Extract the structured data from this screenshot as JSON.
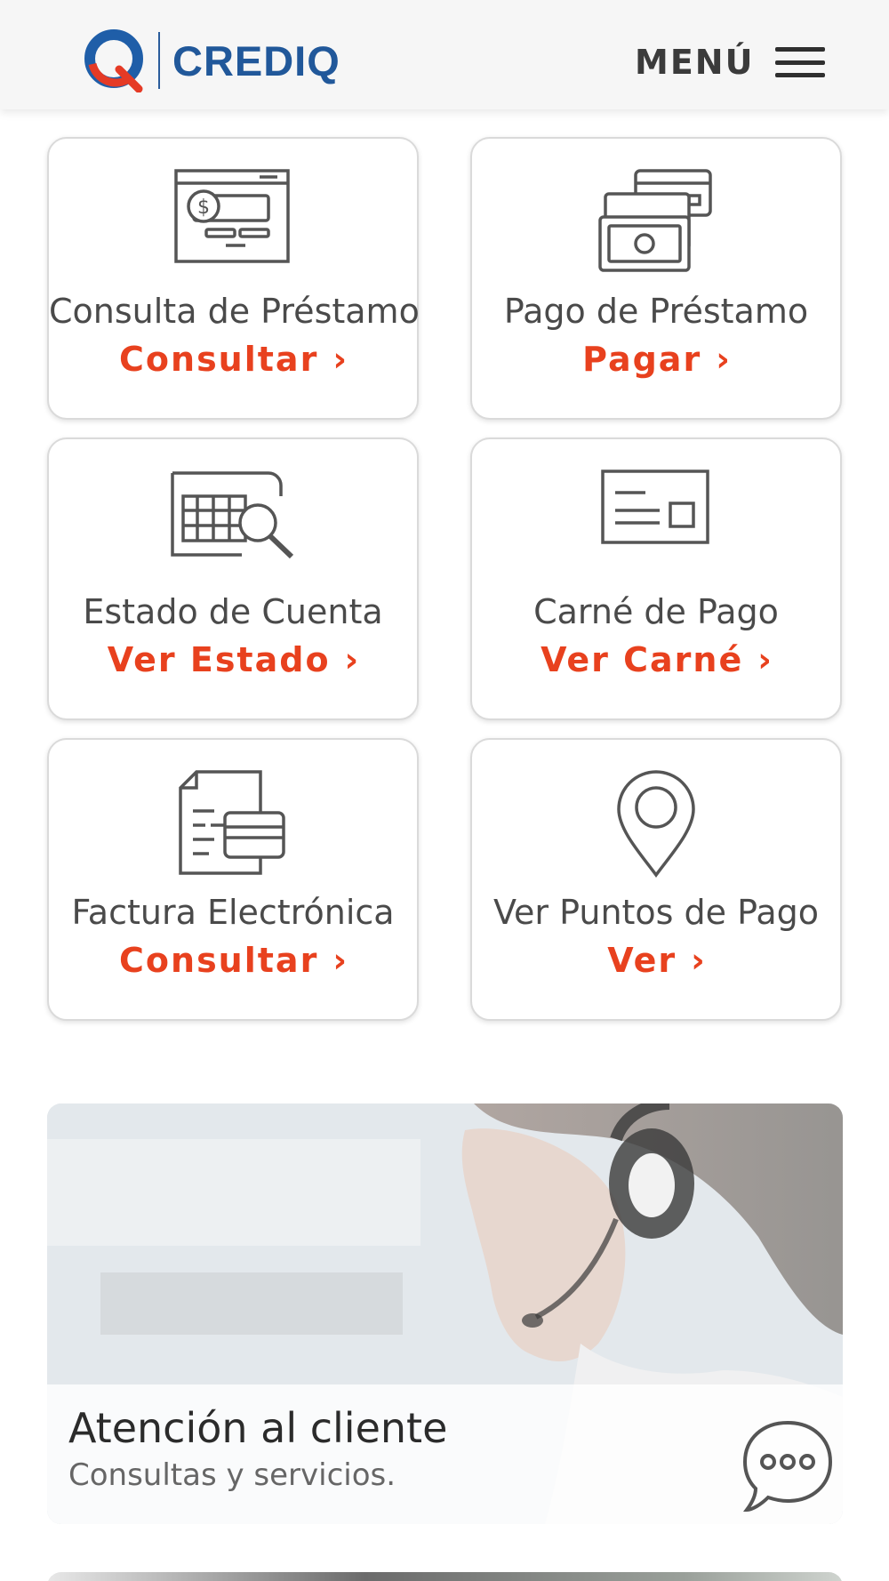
{
  "header": {
    "logo_text": "CREDIQ",
    "menu_label": "MENÚ"
  },
  "cards": [
    {
      "title": "Consulta de Préstamo",
      "action": "Consultar",
      "icon": "loan-statement-icon"
    },
    {
      "title": "Pago de Préstamo",
      "action": "Pagar",
      "icon": "payment-cards-cash-icon"
    },
    {
      "title": "Estado de Cuenta",
      "action": "Ver Estado",
      "icon": "account-statement-search-icon"
    },
    {
      "title": "Carné de Pago",
      "action": "Ver Carné",
      "icon": "payment-card-icon"
    },
    {
      "title": "Factura Electrónica",
      "action": "Consultar",
      "icon": "electronic-invoice-icon"
    },
    {
      "title": "Ver Puntos de Pago",
      "action": "Ver",
      "icon": "location-pin-icon"
    }
  ],
  "chevron": "›",
  "banner": {
    "title": "Atención al cliente",
    "subtitle": "Consultas y servicios.",
    "icon": "chat-bubble-icon"
  },
  "colors": {
    "brand_blue": "#21589a",
    "action_orange": "#e8411e",
    "icon_gray": "#555555"
  }
}
